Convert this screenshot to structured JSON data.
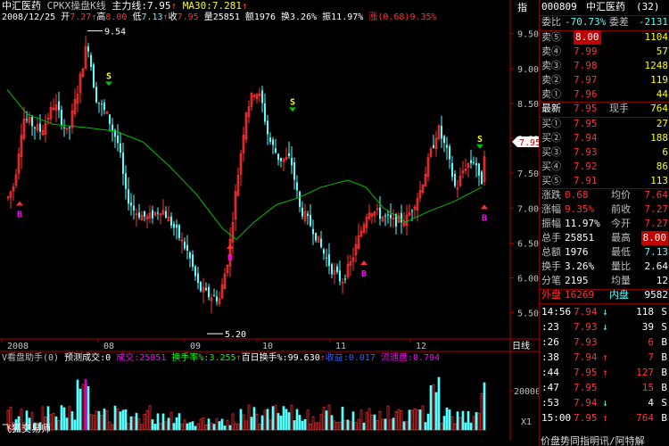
{
  "header": {
    "stock_name": "中汇医药",
    "indicator_name": "CPKX操盘K线",
    "main_line_label": "主力线:",
    "main_line_value": "7.95",
    "ma30_label": "MA30:",
    "ma30_value": "7.281",
    "right_tab": "指"
  },
  "info_bar": {
    "date": "2008/12/25",
    "open_label": "开",
    "open": "7.27",
    "high_label": "高",
    "high": "8.00",
    "low_label": "低",
    "low": "7.13",
    "close_label": "收",
    "close": "7.95",
    "volume_label": "量",
    "volume": "25851",
    "amount_label": "额",
    "amount": "1976",
    "turnover_label": "换",
    "turnover": "3.26%",
    "amplitude_label": "振",
    "amplitude": "11.97%",
    "change_label": "涨",
    "change": "(0.68)",
    "change_pct": "9.35%"
  },
  "price_axis": [
    "9.50",
    "9.00",
    "8.50",
    "8.00",
    "7.50",
    "7.00",
    "6.50",
    "6.00",
    "5.50"
  ],
  "current_price_tag": "7.95",
  "time_axis": [
    "2008",
    "08",
    "09",
    "10",
    "11",
    "12"
  ],
  "period_label": "日线",
  "annotations": {
    "high_label": "9.54",
    "low_label": "5.20",
    "buy": "B",
    "sell": "S"
  },
  "volume_panel": {
    "title": "V看盘助手(0)",
    "forecast_label": "预测成交:",
    "forecast_value": "0",
    "volume_label": "成交:",
    "volume_value": "25851",
    "turnover_rate_label": "换手率%:",
    "turnover_rate_value": "3.255",
    "hundred_day_label": "百日换手%:",
    "hundred_day_value": "99.630",
    "earnings_label": "收益:",
    "earnings_value": "0.017",
    "float_label": "流通盘:",
    "float_value": "0.794",
    "axis_label": "20000",
    "axis_unit": "X1"
  },
  "footer": {
    "software": "飞狐交易师",
    "right_note": "价盘势同指明讯/阿特解"
  },
  "quote_panel": {
    "code": "000809",
    "name": "中汇医药",
    "count": "(32)",
    "weibi": {
      "l1": "委比",
      "v1": "-70.73%",
      "l2": "委差",
      "v2": "-2131"
    },
    "sell": [
      {
        "label": "卖⑤",
        "price": "8.00",
        "vol": "1104"
      },
      {
        "label": "卖④",
        "price": "7.99",
        "vol": "57"
      },
      {
        "label": "卖③",
        "price": "7.98",
        "vol": "1248"
      },
      {
        "label": "卖②",
        "price": "7.97",
        "vol": "119"
      },
      {
        "label": "卖①",
        "price": "7.96",
        "vol": "44"
      }
    ],
    "latest": {
      "label": "最新",
      "price": "7.95",
      "l2": "现手",
      "v2": "764"
    },
    "buy": [
      {
        "label": "买①",
        "price": "7.95",
        "vol": "27"
      },
      {
        "label": "买②",
        "price": "7.94",
        "vol": "188"
      },
      {
        "label": "买③",
        "price": "7.93",
        "vol": "6"
      },
      {
        "label": "买④",
        "price": "7.92",
        "vol": "86"
      },
      {
        "label": "买⑤",
        "price": "7.91",
        "vol": "113"
      }
    ],
    "stats": [
      {
        "l1": "涨跌",
        "v1": "0.68",
        "l2": "均价",
        "v2": "7.64"
      },
      {
        "l1": "涨幅",
        "v1": "9.35%",
        "l2": "前收",
        "v2": "7.27"
      },
      {
        "l1": "振幅",
        "v1": "11.97%",
        "l2": "今开",
        "v2": "7.27"
      },
      {
        "l1": "总手",
        "v1": "25851",
        "l2": "最高",
        "v2": "8.00"
      },
      {
        "l1": "总额",
        "v1": "1976",
        "l2": "最低",
        "v2": "7.13"
      },
      {
        "l1": "换手",
        "v1": "3.26%",
        "l2": "量比",
        "v2": "2.64"
      },
      {
        "l1": "分笔",
        "v1": "2195",
        "l2": "均量",
        "v2": "12"
      }
    ],
    "outer": {
      "l1": "外盘",
      "v1": "16269",
      "l2": "内盘",
      "v2": "9582"
    },
    "ticks": [
      {
        "time": "14:56",
        "price": "7.94",
        "dir": "↓",
        "vol": "118",
        "side": "S"
      },
      {
        "time": ":23",
        "price": "7.93",
        "dir": "↓",
        "vol": "39",
        "side": "S"
      },
      {
        "time": ":26",
        "price": "7.93",
        "dir": "",
        "vol": "6",
        "side": "B"
      },
      {
        "time": ":38",
        "price": "7.94",
        "dir": "↑",
        "vol": "7",
        "side": "B"
      },
      {
        "time": ":44",
        "price": "7.95",
        "dir": "↑",
        "vol": "127",
        "side": "B"
      },
      {
        "time": ":47",
        "price": "7.95",
        "dir": "",
        "vol": "15",
        "side": "B"
      },
      {
        "time": ":53",
        "price": "7.94",
        "dir": "↓",
        "vol": "4",
        "side": "S"
      },
      {
        "time": "15:00",
        "price": "7.95",
        "dir": "↑",
        "vol": "764",
        "side": "B"
      }
    ]
  },
  "colors": {
    "up": "#ff3232",
    "down": "#54ffff",
    "ma": "#00c000",
    "axis": "#b00000",
    "white": "#ffffff",
    "yellow": "#ffff00",
    "magenta": "#ff00ff"
  }
}
